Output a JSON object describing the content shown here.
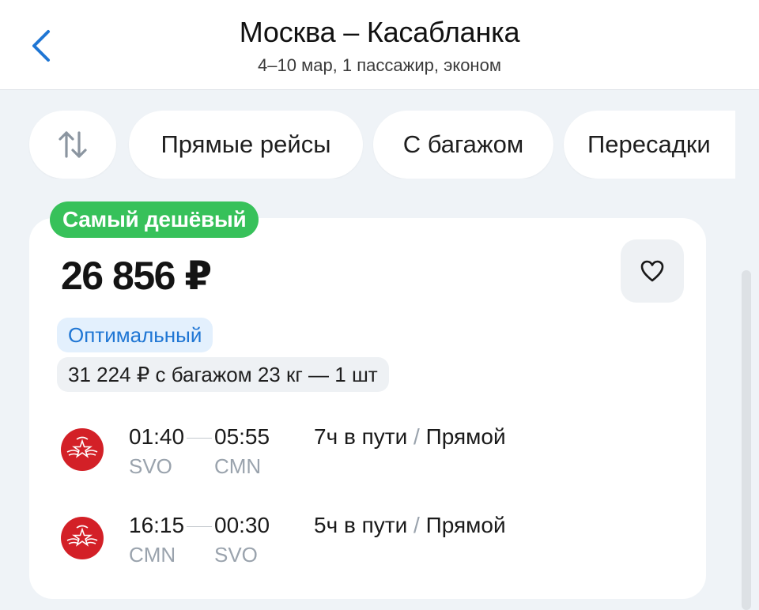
{
  "header": {
    "title": "Москва – Касабланка",
    "subtitle": "4–10 мар, 1 пассажир, эконом"
  },
  "filters": {
    "sort_icon": "sort-arrows-icon",
    "chips": [
      "Прямые рейсы",
      "С багажом",
      "Пересадки"
    ]
  },
  "ticket": {
    "badge": "Самый дешёвый",
    "price": "26 856 ₽",
    "tag_optimal": "Оптимальный",
    "baggage_offer": "31 224 ₽ с багажом 23 кг — 1 шт",
    "segments": [
      {
        "dep_time": "01:40",
        "arr_time": "05:55",
        "dep_code": "SVO",
        "arr_code": "CMN",
        "duration": "7ч в пути",
        "separator": "/",
        "type": "Прямой"
      },
      {
        "dep_time": "16:15",
        "arr_time": "00:30",
        "dep_code": "CMN",
        "arr_code": "SVO",
        "duration": "5ч в пути",
        "separator": "/",
        "type": "Прямой"
      }
    ]
  },
  "colors": {
    "badge_green": "#37c15a",
    "accent_blue": "#1f76d4",
    "airline_red": "#d32027"
  }
}
